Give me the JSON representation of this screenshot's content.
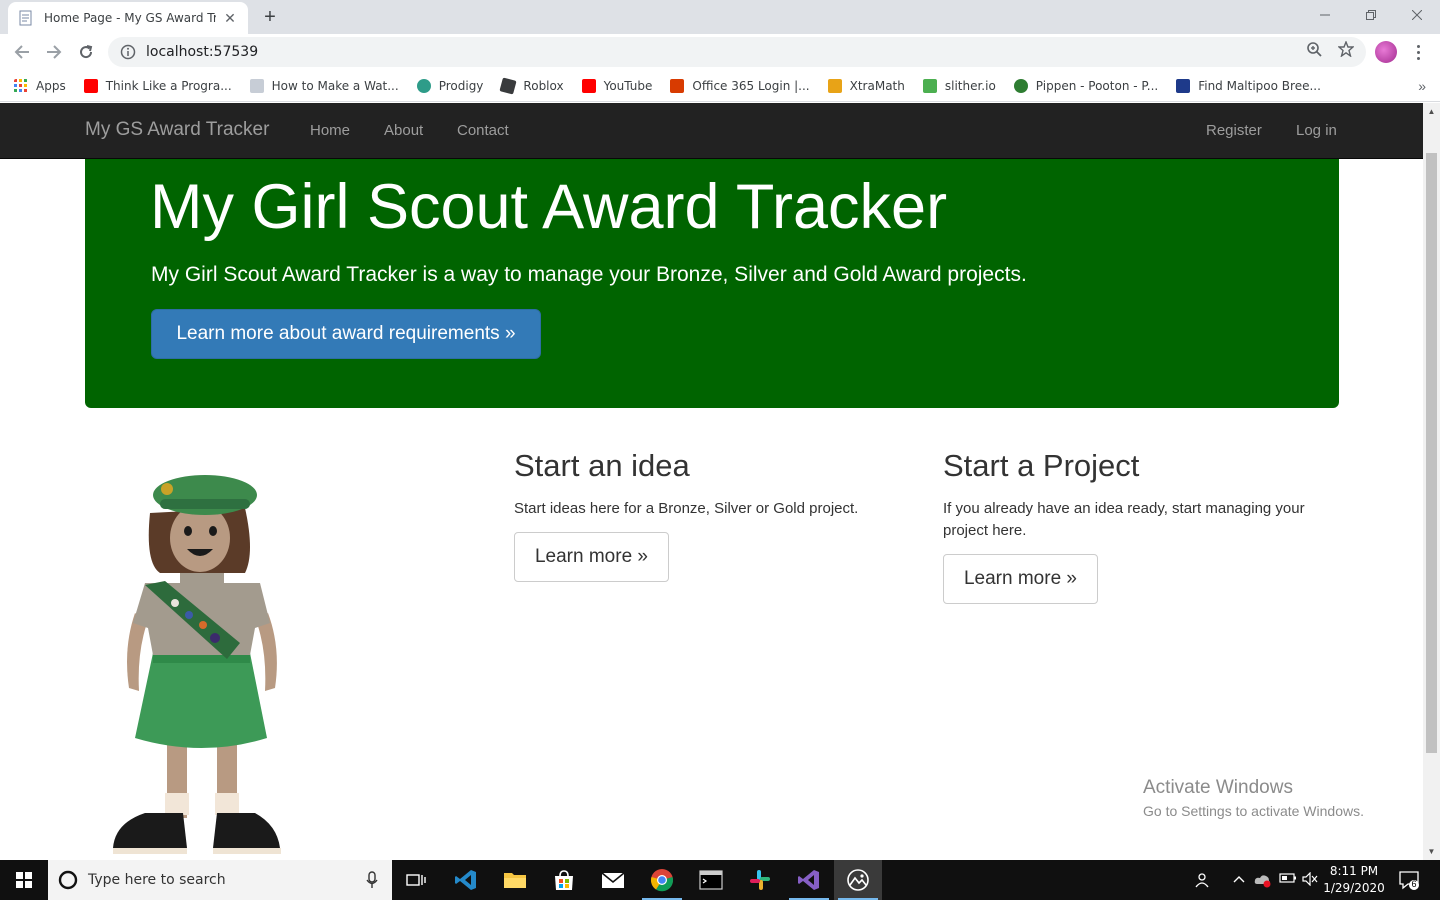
{
  "browser": {
    "tab_title": "Home Page - My GS Award Tracker",
    "url": "localhost:57539",
    "bookmarks": [
      {
        "label": "Apps",
        "color": "#ea4335"
      },
      {
        "label": "Think Like a Progra...",
        "color": "#ff0000"
      },
      {
        "label": "How to Make a Wat...",
        "color": "#9aa0a6"
      },
      {
        "label": "Prodigy",
        "color": "#2e9c89"
      },
      {
        "label": "Roblox",
        "color": "#393b3d"
      },
      {
        "label": "YouTube",
        "color": "#ff0000"
      },
      {
        "label": "Office 365 Login |...",
        "color": "#d83b01"
      },
      {
        "label": "XtraMath",
        "color": "#e8a317"
      },
      {
        "label": "slither.io",
        "color": "#4caf50"
      },
      {
        "label": "Pippen - Pooton - P...",
        "color": "#2e7d32"
      },
      {
        "label": "Find Maltipoo Bree...",
        "color": "#1e3a8a"
      }
    ]
  },
  "navbar": {
    "brand": "My GS Award Tracker",
    "links": [
      "Home",
      "About",
      "Contact"
    ],
    "right_links": [
      "Register",
      "Log in"
    ]
  },
  "jumbotron": {
    "title": "My Girl Scout Award Tracker",
    "lead": "My Girl Scout Award Tracker is a way to manage your Bronze, Silver and Gold Award projects.",
    "button": "Learn more about award requirements »",
    "color": "#006400"
  },
  "columns": [
    {
      "heading": "Start an idea",
      "text": "Start ideas here for a Bronze, Silver or Gold project.",
      "button": "Learn more »"
    },
    {
      "heading": "Start a Project",
      "text": "If you already have an idea ready, start managing your project here.",
      "button": "Learn more »"
    }
  ],
  "watermark": {
    "title": "Activate Windows",
    "subtitle": "Go to Settings to activate Windows."
  },
  "taskbar": {
    "search_placeholder": "Type here to search",
    "time": "8:11 PM",
    "date": "1/29/2020",
    "notification_count": "6"
  }
}
